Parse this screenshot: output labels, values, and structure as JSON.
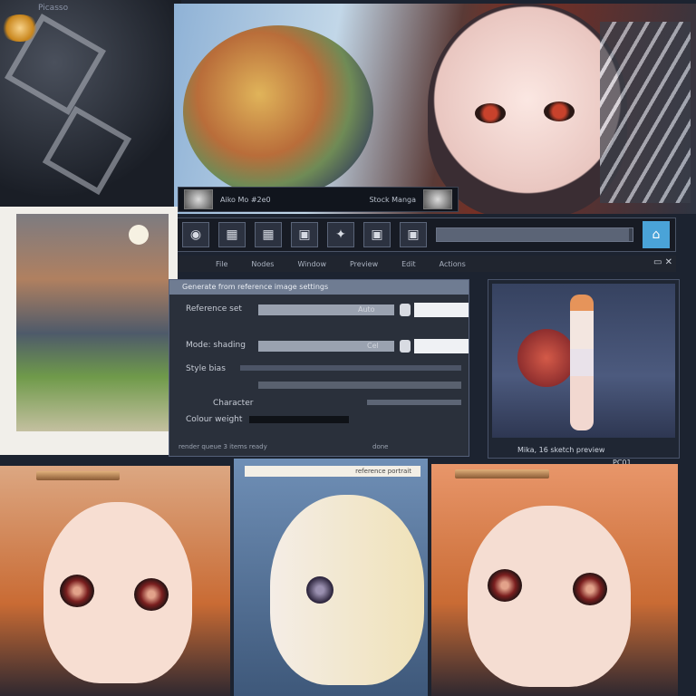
{
  "window": {
    "title": "Picasso"
  },
  "media_bar": {
    "left_label": "Aiko Mo #2e0",
    "right_label": "Stock Manga"
  },
  "toolbar": {
    "progress": 0.98
  },
  "menu": {
    "items": [
      "File",
      "Nodes",
      "Window",
      "Preview",
      "Edit",
      "Actions"
    ]
  },
  "dialog": {
    "title": "Generate from reference image settings",
    "rows": [
      {
        "label": "Reference set",
        "value": "Auto"
      },
      {
        "label": "Mode: shading",
        "value": "Cel"
      },
      {
        "label": "Style bias",
        "value": ""
      },
      {
        "label": "Character",
        "value": ""
      },
      {
        "label": "Colour weight",
        "value": ""
      }
    ],
    "status_left": "render queue 3 items  ready",
    "status_right": "done"
  },
  "preview": {
    "caption": "Mika, 16  sketch preview",
    "tag": "PC01"
  },
  "panels": {
    "mid_header": "reference portrait"
  },
  "colors": {
    "accent": "#4aa3d8",
    "panel": "#2a303b",
    "titlebar": "#6f7c92"
  },
  "icons": [
    "flower-icon",
    "image-icon",
    "grid-icon",
    "photo-icon",
    "sparkle-icon",
    "home-icon",
    "camera-icon"
  ]
}
